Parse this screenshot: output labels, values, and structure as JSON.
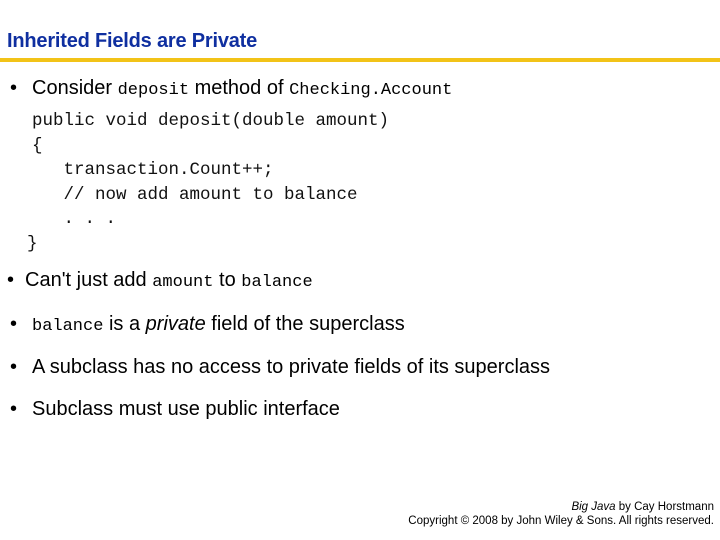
{
  "slide": {
    "title": "Inherited Fields are Private",
    "accent_color": "#f2c318",
    "title_color": "#0f2fa0"
  },
  "bullets": [
    {
      "parts": [
        "Consider ",
        "deposit",
        " method of ",
        "Checking.Account"
      ]
    },
    {
      "parts": [
        "Can't just add ",
        "amount",
        " to ",
        "balance"
      ]
    },
    {
      "parts": [
        "balance",
        " is a ",
        "private",
        " field of the superclass"
      ]
    },
    {
      "text": "A subclass has no access to private fields of its superclass"
    },
    {
      "text": "Subclass must use public interface"
    }
  ],
  "code_lines": [
    "public void deposit(double amount)",
    "{",
    "   transaction.Count++;",
    "   // now add amount to balance",
    "   . . .",
    "}"
  ],
  "footer": {
    "book": "Big Java",
    "by_author": " by Cay Horstmann",
    "copyright": "Copyright © 2008 by John Wiley & Sons.  All rights reserved."
  }
}
